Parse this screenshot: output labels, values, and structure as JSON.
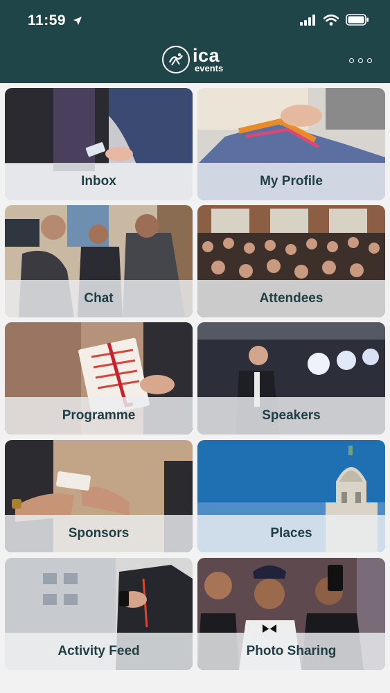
{
  "status_bar": {
    "time": "11:59",
    "icons": [
      "location-arrow-icon",
      "signal-icon",
      "wifi-icon",
      "battery-icon"
    ]
  },
  "header": {
    "logo": {
      "primary": "ica",
      "secondary": "events"
    },
    "menu_icon": "more-icon"
  },
  "tiles": [
    {
      "label": "Inbox"
    },
    {
      "label": "My Profile"
    },
    {
      "label": "Chat"
    },
    {
      "label": "Attendees"
    },
    {
      "label": "Programme"
    },
    {
      "label": "Speakers"
    },
    {
      "label": "Sponsors"
    },
    {
      "label": "Places"
    },
    {
      "label": "Activity Feed"
    },
    {
      "label": "Photo Sharing"
    }
  ],
  "colors": {
    "header_bg": "#1f4549",
    "label_text": "#1f3f44",
    "label_band": "#eceef0"
  }
}
